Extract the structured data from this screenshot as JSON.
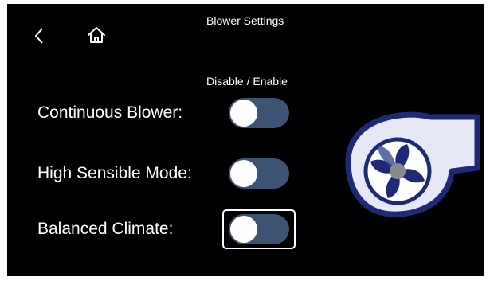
{
  "header": {
    "title": "Blower Settings",
    "back_icon": "chevron-left-icon",
    "home_icon": "home-icon"
  },
  "column_header": "Disable / Enable",
  "settings": [
    {
      "label": "Continuous Blower:",
      "enabled": false,
      "focused": false
    },
    {
      "label": "High Sensible Mode:",
      "enabled": false,
      "focused": false
    },
    {
      "label": "Balanced Climate:",
      "enabled": false,
      "focused": true
    }
  ],
  "graphic": {
    "icon": "blower-fan-icon"
  },
  "colors": {
    "background": "#000000",
    "text": "#ffffff",
    "toggle_track": "#3d5373",
    "toggle_knob": "#ffffff",
    "blower_outline": "#1e2a78",
    "blower_fill": "#e6e8f5",
    "fan_center": "#8a8a8a"
  }
}
